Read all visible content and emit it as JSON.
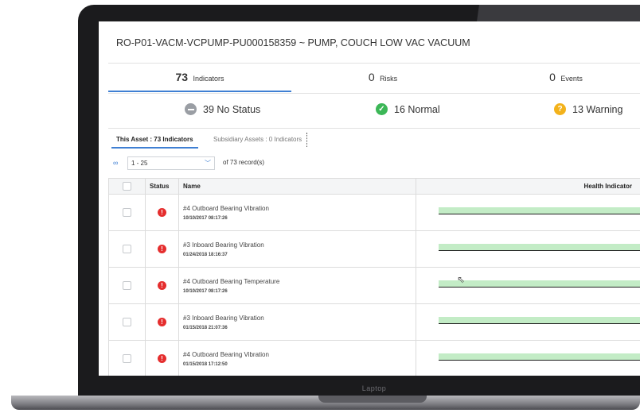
{
  "device": {
    "label": "Laptop"
  },
  "asset": {
    "title": "RO-P01-VACM-VCPUMP-PU000158359 ~ PUMP, COUCH LOW VAC VACUUM"
  },
  "summary_tabs": [
    {
      "count": "73",
      "label": "Indicators",
      "active": true
    },
    {
      "count": "0",
      "label": "Risks",
      "active": false
    },
    {
      "count": "0",
      "label": "Events",
      "active": false
    }
  ],
  "status_summary": [
    {
      "text": "39 No Status",
      "icon": "no-status-icon",
      "color": "#9a9ea4"
    },
    {
      "text": "16 Normal",
      "icon": "check-icon",
      "color": "#3cb757"
    },
    {
      "text": "13 Warning",
      "icon": "warning-icon",
      "color": "#f3b21b"
    }
  ],
  "sub_tabs": [
    {
      "label": "This Asset : 73 Indicators",
      "active": true
    },
    {
      "label": "Subsidiary Assets : 0 Indicators",
      "active": false
    }
  ],
  "pager": {
    "range": "1 - 25",
    "records": "of 73 record(s)"
  },
  "grid": {
    "columns": {
      "status": "Status",
      "name": "Name",
      "health": "Health Indicator"
    },
    "rows": [
      {
        "name": "#4 Outboard Bearing Vibration",
        "date": "10/10/2017 08:17:26",
        "status": "alert",
        "axis": "0"
      },
      {
        "name": "#3 Inboard Bearing Vibration",
        "date": "01/24/2018 18:16:37",
        "status": "alert",
        "axis": "0"
      },
      {
        "name": "#4 Outboard Bearing Temperature",
        "date": "10/10/2017 08:17:26",
        "status": "alert",
        "axis": "0"
      },
      {
        "name": "#3 Inboard Bearing Vibration",
        "date": "01/15/2018 21:07:36",
        "status": "alert",
        "axis": "0"
      },
      {
        "name": "#4 Outboard Bearing Vibration",
        "date": "01/15/2018 17:12:50",
        "status": "alert",
        "axis": "0"
      }
    ]
  },
  "colors": {
    "accent": "#3f7fd3",
    "alert": "#e52e2e",
    "health_fill": "#c3ecc6"
  }
}
